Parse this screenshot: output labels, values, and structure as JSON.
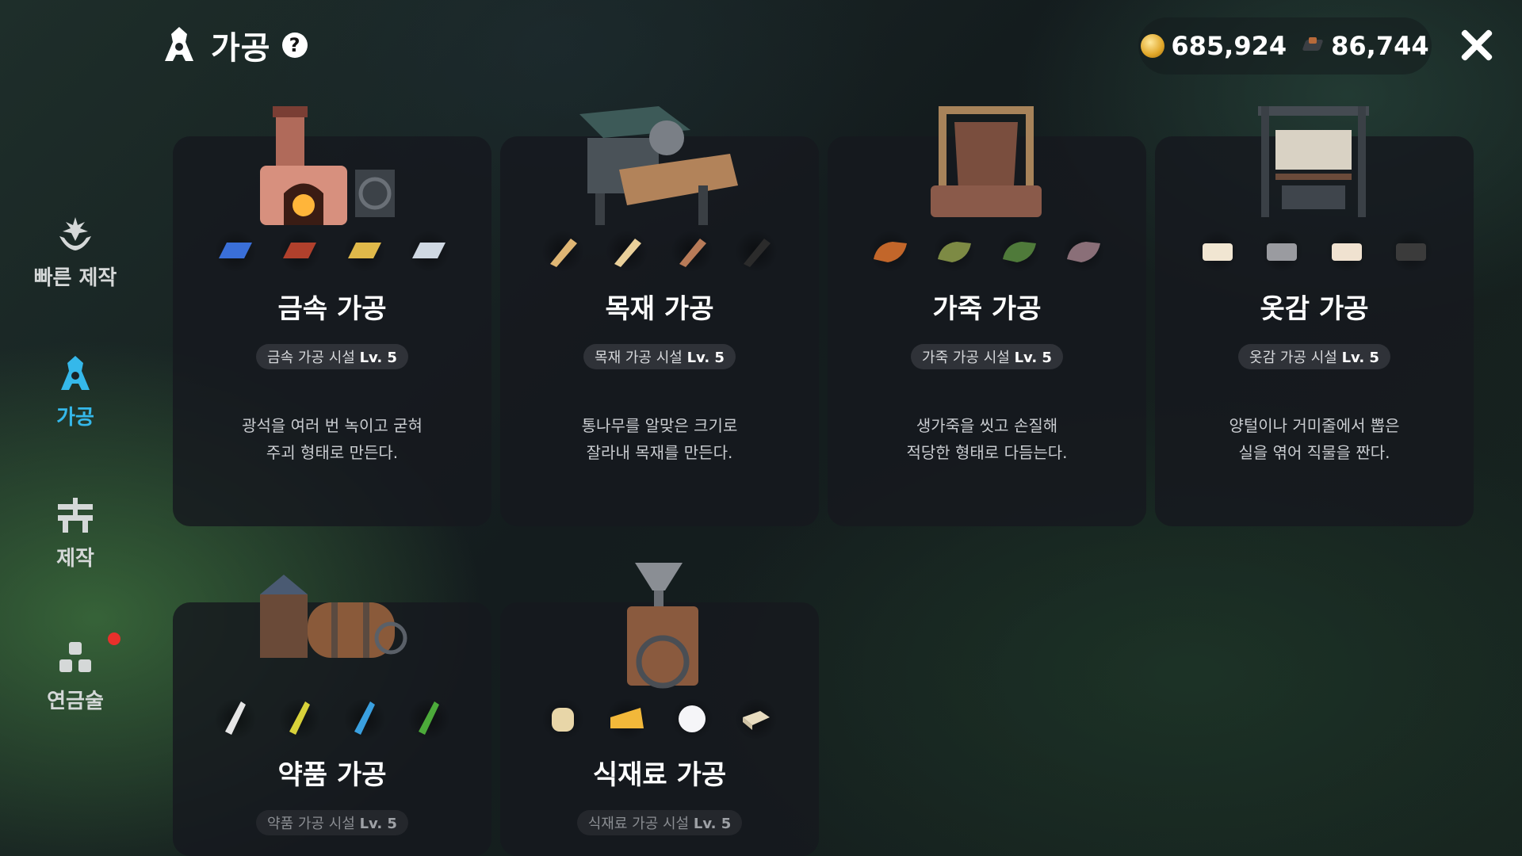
{
  "header": {
    "title": "가공",
    "help": "?"
  },
  "currency": {
    "gold": "685,924",
    "secondary": "86,744"
  },
  "sidebar": {
    "items": [
      {
        "label": "빠른 제작",
        "icon": "sparkle-hands-icon"
      },
      {
        "label": "가공",
        "icon": "processing-icon",
        "active": true
      },
      {
        "label": "제작",
        "icon": "anvil-icon"
      },
      {
        "label": "연금술",
        "icon": "alchemy-icon",
        "badge": true
      }
    ]
  },
  "cards": [
    {
      "title": "금속 가공",
      "facility": "금속 가공 시설",
      "level": "Lv. 5",
      "desc1": "광석을 여러 번 녹이고 굳혀",
      "desc2": "주괴 형태로 만든다.",
      "materials": [
        "#3a6fd8",
        "#b0402c",
        "#e0b94a",
        "#cfd8e2"
      ]
    },
    {
      "title": "목재 가공",
      "facility": "목재 가공 시설",
      "level": "Lv. 5",
      "desc1": "통나무를 알맞은 크기로",
      "desc2": "잘라내 목재를 만든다.",
      "materials": [
        "#e0b674",
        "#ead09a",
        "#b87b58",
        "#2b2b2b"
      ]
    },
    {
      "title": "가죽 가공",
      "facility": "가죽 가공 시설",
      "level": "Lv. 5",
      "desc1": "생가죽을 씻고 손질해",
      "desc2": "적당한 형태로 다듬는다.",
      "materials": [
        "#c2662a",
        "#7d8a44",
        "#4f7a3a",
        "#8a6f78"
      ]
    },
    {
      "title": "옷감 가공",
      "facility": "옷감 가공 시설",
      "level": "Lv. 5",
      "desc1": "양털이나 거미줄에서 뽑은",
      "desc2": "실을 엮어 직물을 짠다.",
      "materials": [
        "#f1e6d2",
        "#9a9ba0",
        "#f0e2d0",
        "#3b3b3b"
      ]
    },
    {
      "title": "약품 가공",
      "facility": "약품 가공 시설",
      "level": "Lv. 5",
      "materials": [
        "#e6e6e6",
        "#d8d23a",
        "#3aa0e0",
        "#4caa3a"
      ]
    },
    {
      "title": "식재료 가공",
      "facility": "식재료 가공 시설",
      "level": "Lv. 5",
      "materials": [
        "#e8d6a8",
        "#f2b83a",
        "#f5f5f8",
        "#e8dcc0"
      ]
    }
  ]
}
